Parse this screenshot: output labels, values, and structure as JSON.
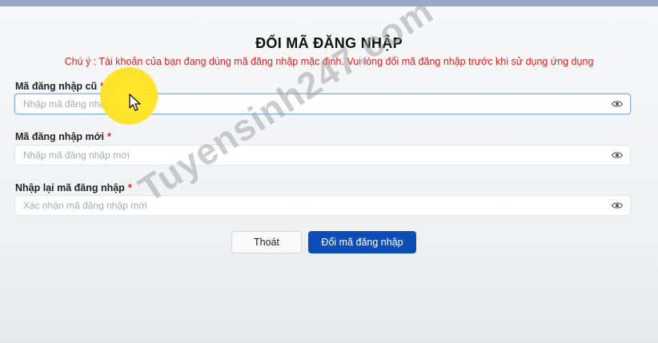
{
  "header": {
    "title": "ĐỔI MÃ ĐĂNG NHẬP"
  },
  "notice": {
    "text": "Chú ý : Tài khoản của bạn đang dùng mã đăng nhập mặc định. Vui lòng đổi mã đăng nhập trước khi sử dụng ứng dụng"
  },
  "form": {
    "required_mark": "*",
    "old_code": {
      "label": "Mã đăng nhập cũ",
      "placeholder": "Nhập mã đăng nhập cũ",
      "value": ""
    },
    "new_code": {
      "label": "Mã đăng nhập mới",
      "placeholder": "Nhập mã đăng nhập mới",
      "value": ""
    },
    "confirm_code": {
      "label": "Nhập lại mã đăng nhập",
      "placeholder": "Xác nhận mã đăng nhập mới",
      "value": ""
    }
  },
  "actions": {
    "cancel_label": "Thoát",
    "submit_label": "Đổi mã đăng nhập"
  },
  "watermark": {
    "text": "Tuyensinh247.com"
  },
  "icons": {
    "visibility": "eye-icon",
    "pointer": "mouse-cursor-icon"
  },
  "colors": {
    "accent": "#0d4db8",
    "warning": "#e02020",
    "focus_border": "#7fb0ea",
    "highlight": "#ffe31a"
  }
}
